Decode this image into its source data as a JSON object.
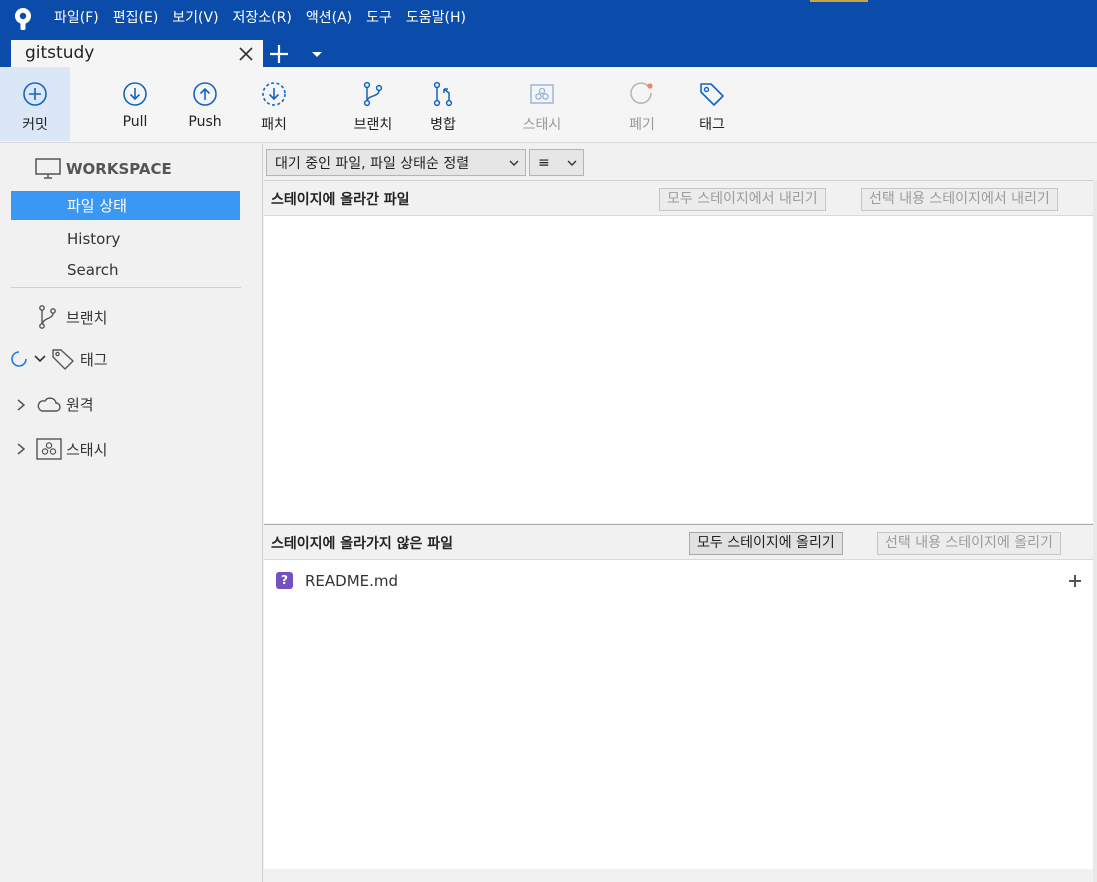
{
  "app": {
    "menu": [
      "파일(F)",
      "편집(E)",
      "보기(V)",
      "저장소(R)",
      "액션(A)",
      "도구",
      "도움말(H)"
    ]
  },
  "tabs": [
    {
      "label": "gitstudy"
    }
  ],
  "toolbar": {
    "commit": "커밋",
    "pull": "Pull",
    "push": "Push",
    "patch": "패치",
    "branch": "브랜치",
    "merge": "병합",
    "stash": "스태시",
    "discard": "폐기",
    "tag": "태그"
  },
  "sidebar": {
    "workspace": "WORKSPACE",
    "items": [
      {
        "label": "파일 상태"
      },
      {
        "label": "History"
      },
      {
        "label": "Search"
      }
    ],
    "branches": "브랜치",
    "tags": "태그",
    "remotes": "원격",
    "stashes": "스태시"
  },
  "filter": {
    "sort": "대기 중인 파일, 파일 상태순 정렬",
    "view": "≡"
  },
  "staged": {
    "title": "스테이지에 올라간 파일",
    "unstage_all": "모두 스테이지에서 내리기",
    "unstage_selected": "선택 내용 스테이지에서 내리기",
    "files": []
  },
  "unstaged": {
    "title": "스테이지에 올라가지 않은 파일",
    "stage_all": "모두 스테이지에 올리기",
    "stage_selected": "선택 내용 스테이지에 올리기",
    "files": [
      {
        "status": "?",
        "name": "README.md"
      }
    ]
  },
  "colors": {
    "titlebar": "#0b4caa",
    "selection": "#3a97f3",
    "toolbar_icon": "#1565c0",
    "untracked_badge": "#7451c2"
  }
}
